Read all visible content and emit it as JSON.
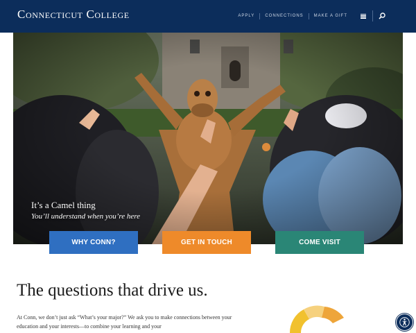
{
  "header": {
    "brand": "Connecticut College",
    "nav": [
      "APPLY",
      "CONNECTIONS",
      "MAKE A GIFT"
    ],
    "menu_icon": "hamburger-menu-icon",
    "search_icon": "search-icon",
    "background": "#0c2d5b"
  },
  "hero": {
    "title": "It’s a Camel thing",
    "subtitle": "You’ll understand when you’re here"
  },
  "cta": {
    "why": "WHY CONN?",
    "touch": "GET IN TOUCH",
    "visit": "COME VISIT",
    "colors": {
      "why": "#2f6fc1",
      "touch": "#ee8a2a",
      "visit": "#2a8676"
    }
  },
  "content": {
    "heading": "The questions that drive us.",
    "paragraph": "At Conn, we don’t just ask “What’s your major?” We ask you to make connections between your education and your interests—to combine your learning and your"
  },
  "accessibility": {
    "icon": "accessibility-icon"
  }
}
